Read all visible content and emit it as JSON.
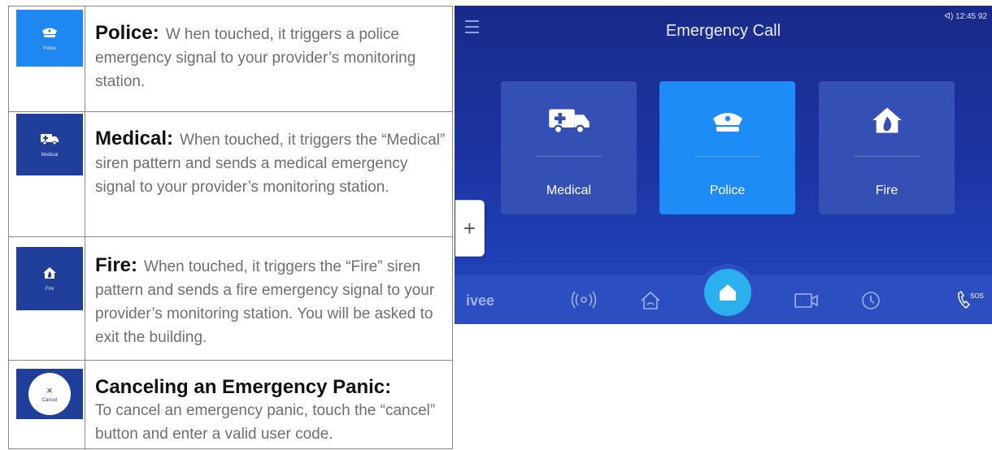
{
  "manual": {
    "rows": [
      {
        "thumb_label": "Police",
        "heading": "Police:",
        "text": "W hen touched, it triggers a police emergency signal to your provider’s monitoring station."
      },
      {
        "thumb_label": "Medical",
        "heading": "Medical:",
        "text": "When touched, it triggers the “Medical” siren pattern and sends a medical emergency signal to your provider’s monitoring station."
      },
      {
        "thumb_label": "Fire",
        "heading": "Fire:",
        "text": "When touched, it triggers the “Fire” siren pattern and sends a fire emergency signal to your provider’s monitoring station. You will be asked to exit the building."
      },
      {
        "thumb_label": "Cancel",
        "thumb_symbol": "×",
        "heading": "Canceling an Emergency Panic:",
        "text": "To cancel an emergency panic, touch the “cancel” button and enter a valid user code."
      }
    ]
  },
  "screen": {
    "title": "Emergency Call",
    "status": "ᐊ) 12:45  92",
    "brand": "ivee",
    "plus_label": "+",
    "tiles": [
      {
        "label": "Medical",
        "icon": "ambulance-icon",
        "active": false
      },
      {
        "label": "Police",
        "icon": "police-cap-icon",
        "active": true
      },
      {
        "label": "Fire",
        "icon": "fire-house-icon",
        "active": false
      }
    ],
    "nav_icons": [
      "radio-waves-icon",
      "home-wifi-icon",
      "home-icon",
      "camera-icon",
      "clock-icon",
      "sos-phone-icon"
    ],
    "sos_label": "SOS"
  },
  "colors": {
    "thumb_blue": "#1f3f9a",
    "active_blue": "#1e8cf6",
    "screen_bg": "#1d36a6",
    "home_button": "#2ab0ef"
  }
}
